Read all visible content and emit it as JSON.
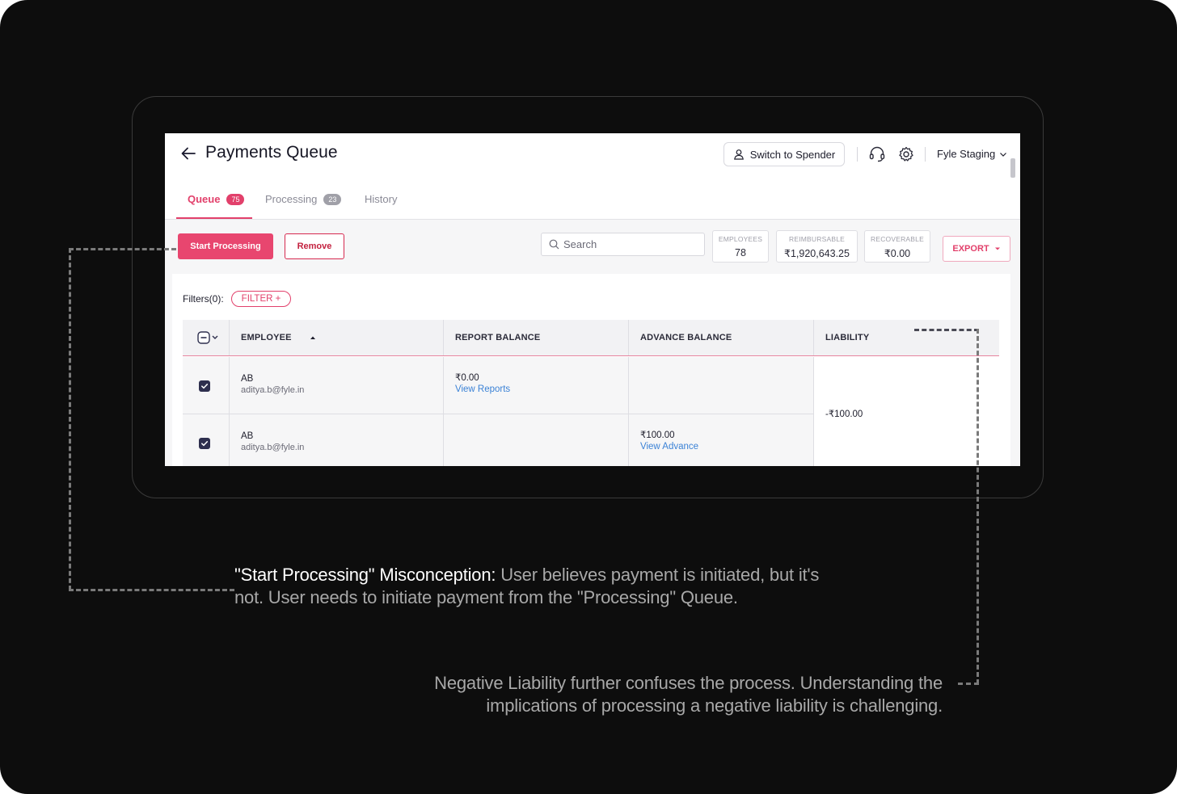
{
  "header": {
    "title": "Payments Queue",
    "switch_label": "Switch to Spender",
    "org_name": "Fyle Staging"
  },
  "tabs": [
    {
      "label": "Queue",
      "count": "75",
      "active": true
    },
    {
      "label": "Processing",
      "count": "23",
      "active": false
    },
    {
      "label": "History",
      "active": false
    }
  ],
  "toolbar": {
    "start_label": "Start Processing",
    "remove_label": "Remove",
    "search_placeholder": "Search",
    "stats": [
      {
        "label": "EMPLOYEES",
        "value": "78"
      },
      {
        "label": "REIMBURSABLE",
        "value": "₹1,920,643.25"
      },
      {
        "label": "RECOVERABLE",
        "value": "₹0.00"
      }
    ],
    "export_label": "EXPORT"
  },
  "filters": {
    "label": "Filters(0):",
    "button_label": "FILTER +"
  },
  "table": {
    "columns": [
      "EMPLOYEE",
      "REPORT BALANCE",
      "ADVANCE BALANCE",
      "LIABILITY"
    ],
    "rows": [
      {
        "name": "AB",
        "email": "aditya.b@fyle.in",
        "report_balance": "₹0.00",
        "report_link": "View Reports",
        "advance_balance": "",
        "advance_link": "",
        "checked": true
      },
      {
        "name": "AB",
        "email": "aditya.b@fyle.in",
        "report_balance": "",
        "report_link": "",
        "advance_balance": "₹100.00",
        "advance_link": "View Advance",
        "checked": true
      }
    ],
    "merged_liability": "-₹100.00"
  },
  "annotations": {
    "note1_bold": "\"Start Processing\" Misconception:",
    "note1_line1": " User believes payment is initiated, but it's",
    "note1_line2": "not. User needs to initiate payment from the \"Processing\" Queue.",
    "note2_line1": "Negative Liability further confuses the process. Understanding the",
    "note2_line2": "implications of processing a negative liability is challenging."
  },
  "colors": {
    "accent": "#e2406b",
    "background": "#0d0d0d",
    "link": "#3b82d6"
  }
}
